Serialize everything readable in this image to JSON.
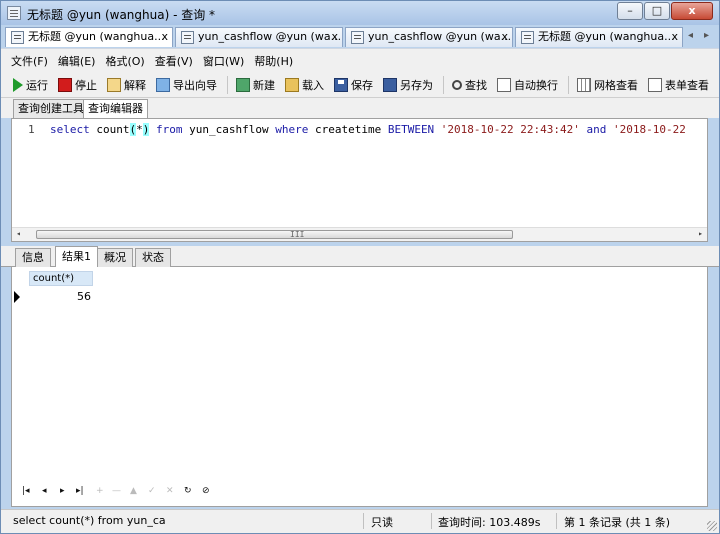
{
  "window": {
    "title": "无标题 @yun (wanghua) - 查询 *",
    "controls": {
      "minimize": "–",
      "maximize": "□",
      "close": "x"
    }
  },
  "doc_tabs": [
    {
      "label": "无标题 @yun (wanghua...",
      "close": "x"
    },
    {
      "label": "yun_cashflow @yun (wa...",
      "close": "x"
    },
    {
      "label": "yun_cashflow @yun (wa...",
      "close": "x"
    },
    {
      "label": "无标题 @yun (wanghua...",
      "close": "x"
    }
  ],
  "doc_tab_nav": {
    "prev": "◂",
    "next": "▸"
  },
  "menu": [
    "文件(F)",
    "编辑(E)",
    "格式(O)",
    "查看(V)",
    "窗口(W)",
    "帮助(H)"
  ],
  "toolbar": {
    "run": "运行",
    "stop": "停止",
    "explain": "解释",
    "export_wizard": "导出向导",
    "new": "新建",
    "load": "载入",
    "save": "保存",
    "save_as": "另存为",
    "find": "查找",
    "word_wrap": "自动换行",
    "grid_view": "网格查看",
    "form_view": "表单查看"
  },
  "sub_tabs": [
    "查询创建工具",
    "查询编辑器"
  ],
  "editor": {
    "line_number": "1",
    "code": {
      "kw_select": "select",
      "fn_count": " count",
      "paren_open": "(",
      "star": "*",
      "paren_close": ")",
      "kw_from": " from",
      "table": " yun_cashflow",
      "kw_where": " where",
      "column": "   createtime",
      "kw_between": " BETWEEN",
      "str_start": " '2018-10-22 22:43:42'",
      "kw_and": " and",
      "str_end": " '2018-10-22"
    },
    "scroll_grip": "III",
    "scroll_left": "◂",
    "scroll_right": "▸"
  },
  "result_tabs": [
    "信息",
    "结果1",
    "概况",
    "状态"
  ],
  "result_grid": {
    "columns": [
      "count(*)"
    ],
    "rows": [
      [
        "56"
      ]
    ]
  },
  "nav_buttons": {
    "first": "|◂",
    "prev": "◂",
    "next": "▸",
    "last": "▸|",
    "add": "+",
    "delete": "—",
    "edit": "▲",
    "apply": "✓",
    "cancel": "✕",
    "refresh": "↻",
    "stop": "⊘"
  },
  "status_bar": {
    "query_text": "select count(*) from yun_cashflc",
    "mode": "只读",
    "query_time": "查询时间: 103.489s",
    "record_info": "第 1 条记录 (共 1 条)"
  }
}
